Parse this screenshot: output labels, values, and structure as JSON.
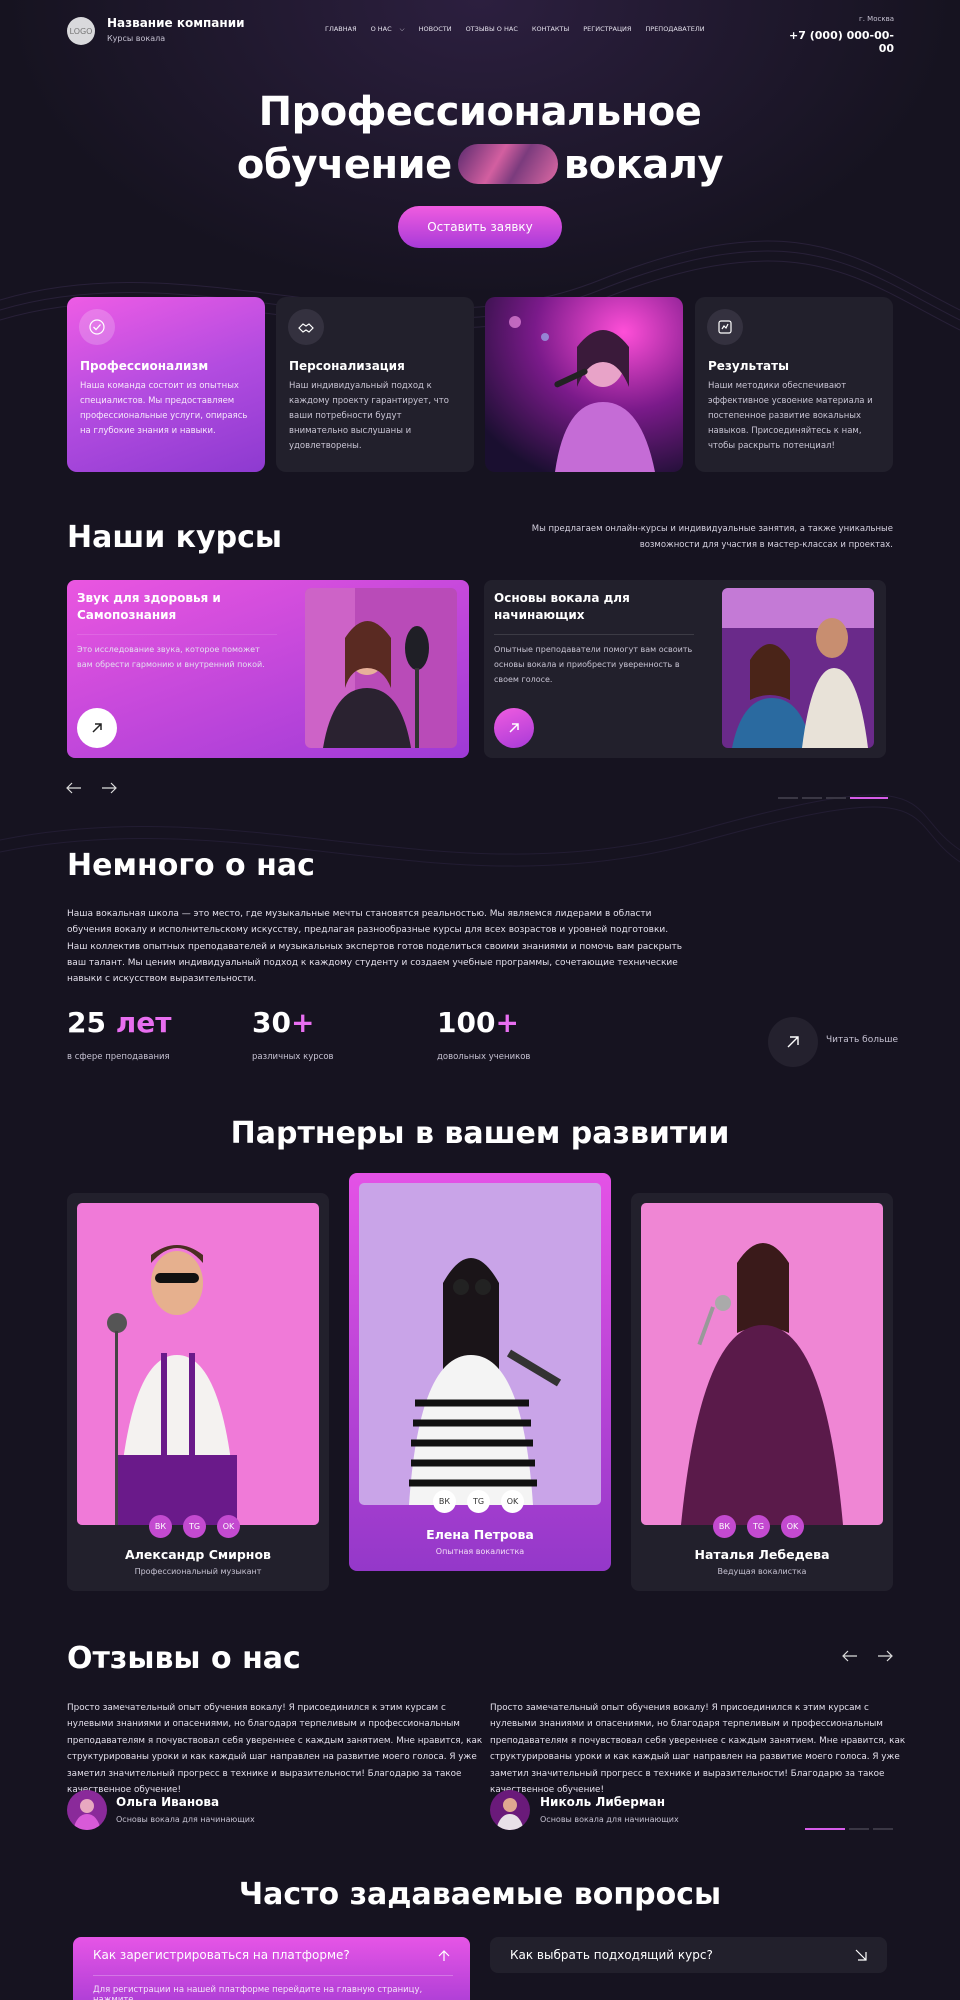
{
  "header": {
    "logo": "LOGO",
    "company": "Название компании",
    "subtitle": "Курсы вокала",
    "nav": [
      "Главная",
      "О нас",
      "Новости",
      "Отзывы о нас",
      "Контакты",
      "Регистрация",
      "Преподаватели"
    ],
    "city": "г. Москва",
    "phone": "+7 (000) 000-00-00"
  },
  "hero": {
    "title_line1": "Профессиональное",
    "title_word1": "обучение",
    "title_word2": "вокалу",
    "cta": "Оставить заявку"
  },
  "features": [
    {
      "icon": "badge-check-icon",
      "title": "Профессионализм",
      "text": "Наша команда состоит из опытных специалистов. Мы предоставляем профессиональные услуги, опираясь на глубокие знания и навыки."
    },
    {
      "icon": "handshake-icon",
      "title": "Персонализация",
      "text": "Наш индивидуальный подход к каждому проекту гарантирует, что ваши потребности будут внимательно выслушаны и удовлетворены."
    },
    {
      "icon": "chart-check-icon",
      "title": "Результаты",
      "text": "Наши методики обеспечивают эффективное усвоение материала и постепенное развитие вокальных навыков. Присоединяйтесь к нам, чтобы раскрыть потенциал!"
    }
  ],
  "courses": {
    "title": "Наши курсы",
    "note": "Мы предлагаем онлайн-курсы и индивидуальные занятия, а также уникальные возможности для участия в мастер-классах и проектах.",
    "items": [
      {
        "title": "Звук для здоровья и Самопознания",
        "text": "Это исследование звука, которое поможет вам обрести гармонию и внутренний покой."
      },
      {
        "title": "Основы вокала для начинающих",
        "text": "Опытные преподаватели помогут вам освоить основы вокала и приобрести уверенность в своем голосе."
      }
    ]
  },
  "about": {
    "title": "Немного о нас",
    "text": "Наша вокальная школа — это место, где музыкальные мечты становятся реальностью. Мы являемся лидерами в области обучения вокалу и исполнительскому искусству, предлагая разнообразные курсы для всех возрастов и уровней подготовки. Наш коллектив опытных преподавателей и музыкальных экспертов готов поделиться своими знаниями и помочь вам раскрыть ваш талант. Мы ценим индивидуальный подход к каждому студенту и создаем учебные программы, сочетающие технические навыки с искусством выразительности.",
    "stats": [
      {
        "num": "25",
        "acc": " лет",
        "label": "в сфере преподавания"
      },
      {
        "num": "30",
        "acc": "+",
        "label": "различных курсов"
      },
      {
        "num": "100",
        "acc": "+",
        "label": "довольных учеников"
      }
    ],
    "more": "Читать больше"
  },
  "partners": {
    "title": "Партнеры в вашем развитии",
    "items": [
      {
        "name": "Александр Смирнов",
        "role": "Профессиональный музыкант"
      },
      {
        "name": "Елена Петрова",
        "role": "Опытная вокалистка"
      },
      {
        "name": "Наталья Лебедева",
        "role": "Ведущая вокалистка"
      }
    ],
    "social": [
      "ВК",
      "TG",
      "OK"
    ]
  },
  "reviews": {
    "title": "Отзывы о нас",
    "items": [
      {
        "text": "Просто замечательный опыт обучения вокалу! Я присоединился к этим курсам с нулевыми знаниями и опасениями, но благодаря терпеливым и профессиональным преподавателям я почувствовал себя увереннее с каждым занятием. Мне нравится, как структурированы уроки и как каждый шаг направлен на развитие моего голоса. Я уже заметил значительный прогресс в технике и выразительности! Благодарю за такое качественное обучение!",
        "name": "Ольга Иванова",
        "course": "Основы вокала для начинающих"
      },
      {
        "text": "Просто замечательный опыт обучения вокалу! Я присоединился к этим курсам с нулевыми знаниями и опасениями, но благодаря терпеливым и профессиональным преподавателям я почувствовал себя увереннее с каждым занятием. Мне нравится, как структурированы уроки и как каждый шаг направлен на развитие моего голоса. Я уже заметил значительный прогресс в технике и выразительности! Благодарю за такое качественное обучение!",
        "name": "Николь Либерман",
        "course": "Основы вокала для начинающих"
      }
    ]
  },
  "faq": {
    "title": "Часто задаваемые вопросы",
    "items": [
      {
        "q": "Как зарегистрироваться на платформе?",
        "a": "Для регистрации на нашей платформе перейдите на главную страницу, нажмите"
      },
      {
        "q": "Как выбрать подходящий курс?"
      }
    ]
  },
  "colors": {
    "accent": "#e86ef0",
    "background": "#161320",
    "card": "#22202c"
  }
}
